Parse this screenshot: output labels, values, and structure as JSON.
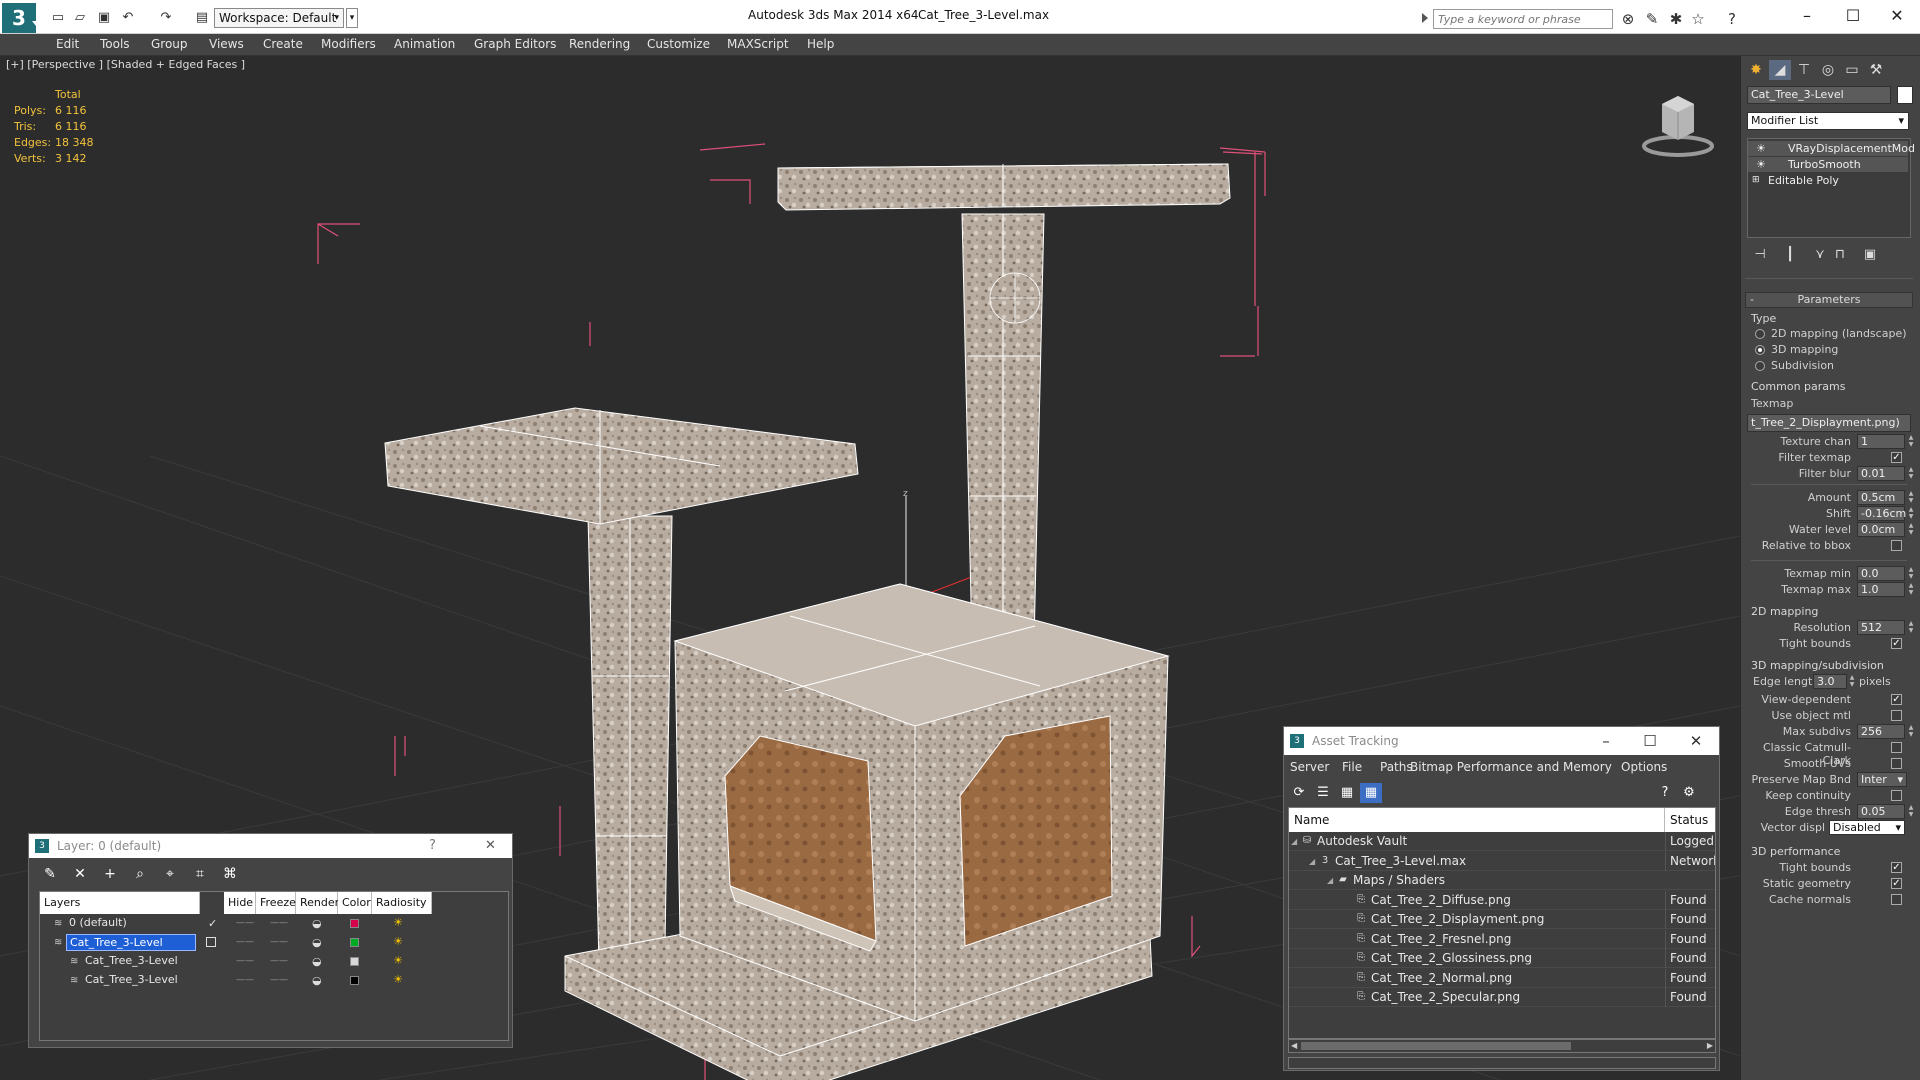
{
  "titlebar": {
    "workspace_label": "Workspace: Default",
    "app_title": "Autodesk 3ds Max  2014 x64",
    "file_title": "Cat_Tree_3-Level.max",
    "search_placeholder": "Type a keyword or phrase"
  },
  "menu": [
    "Edit",
    "Tools",
    "Group",
    "Views",
    "Create",
    "Modifiers",
    "Animation",
    "Graph Editors",
    "Rendering",
    "Customize",
    "MAXScript",
    "Help"
  ],
  "viewport": {
    "label": "[+] [Perspective ] [Shaded + Edged Faces ]",
    "stats_header": "Total",
    "stats": [
      {
        "label": "Polys:",
        "value": "6 116"
      },
      {
        "label": "Tris:",
        "value": "6 116"
      },
      {
        "label": "Edges:",
        "value": "18 348"
      },
      {
        "label": "Verts:",
        "value": "3 142"
      }
    ],
    "axis_label": "z"
  },
  "command_panel": {
    "object_name": "Cat_Tree_3-Level",
    "modifier_list": "Modifier List",
    "stack": [
      "VRayDisplacementMod",
      "TurboSmooth",
      "Editable Poly"
    ],
    "rollout_title": "Parameters",
    "type_label": "Type",
    "type_options": [
      "2D mapping (landscape)",
      "3D mapping",
      "Subdivision"
    ],
    "type_selected": 1,
    "common_label": "Common params",
    "texmap_label": "Texmap",
    "texmap_value": "t_Tree_2_Displayment.png)",
    "params": [
      {
        "label": "Texture chan",
        "value": "1"
      },
      {
        "label": "Filter texmap",
        "check": true
      },
      {
        "label": "Filter blur",
        "value": "0.01"
      },
      {
        "label": "Amount",
        "value": "0.5cm"
      },
      {
        "label": "Shift",
        "value": "-0.16cm"
      },
      {
        "label": "Water level",
        "value": "0.0cm"
      },
      {
        "label": "Relative to bbox",
        "check": false
      },
      {
        "label": "Texmap min",
        "value": "0.0"
      },
      {
        "label": "Texmap max",
        "value": "1.0"
      }
    ],
    "map2d_label": "2D mapping",
    "map2d": [
      {
        "label": "Resolution",
        "value": "512"
      },
      {
        "label": "Tight bounds",
        "check": true
      }
    ],
    "map3d_label": "3D mapping/subdivision",
    "edge_length_label": "Edge length",
    "edge_length_value": "3.0",
    "edge_length_unit": "pixels",
    "map3d": [
      {
        "label": "View-dependent",
        "check": true
      },
      {
        "label": "Use object mtl",
        "check": false
      },
      {
        "label": "Max subdivs",
        "value": "256"
      },
      {
        "label": "Classic Catmull-Clark",
        "check": false
      },
      {
        "label": "Smooth UVs",
        "check": false
      },
      {
        "label": "Preserve Map Bnd",
        "value": "Inter"
      },
      {
        "label": "Keep continuity",
        "check": false
      },
      {
        "label": "Edge thresh",
        "value": "0.05"
      },
      {
        "label": "Vector displ",
        "value": "Disabled"
      }
    ],
    "perf_label": "3D performance",
    "perf": [
      {
        "label": "Tight bounds",
        "check": true
      },
      {
        "label": "Static geometry",
        "check": true
      },
      {
        "label": "Cache normals",
        "check": false
      }
    ]
  },
  "layer_window": {
    "title": "Layer: 0 (default)",
    "help": "?",
    "close": "✕",
    "columns": [
      "Layers",
      "Hide",
      "Freeze",
      "Render",
      "Color",
      "Radiosity"
    ],
    "rows": [
      {
        "name": "0 (default)",
        "color": "#d4004c",
        "selected": false,
        "indent": 0
      },
      {
        "name": "Cat_Tree_3-Level",
        "color": "#00aa22",
        "selected": true,
        "indent": 0
      },
      {
        "name": "Cat_Tree_3-Level",
        "color": "#d8d8d8",
        "selected": false,
        "indent": 1
      },
      {
        "name": "Cat_Tree_3-Level",
        "color": "#000000",
        "selected": false,
        "indent": 1
      }
    ]
  },
  "asset_window": {
    "title": "Asset Tracking",
    "menu": [
      "Server",
      "File",
      "Paths",
      "Bitmap Performance and Memory",
      "Options"
    ],
    "columns": [
      "Name",
      "Status"
    ],
    "rows": [
      {
        "name": "Autodesk Vault",
        "status": "Logged O",
        "indent": 0,
        "icon": "vault-icon"
      },
      {
        "name": "Cat_Tree_3-Level.max",
        "status": "Network",
        "indent": 1,
        "icon": "max-file-icon"
      },
      {
        "name": "Maps / Shaders",
        "status": "",
        "indent": 2,
        "icon": "maps-icon"
      },
      {
        "name": "Cat_Tree_2_Diffuse.png",
        "status": "Found",
        "indent": 3,
        "icon": "bitmap-icon"
      },
      {
        "name": "Cat_Tree_2_Displayment.png",
        "status": "Found",
        "indent": 3,
        "icon": "bitmap-icon"
      },
      {
        "name": "Cat_Tree_2_Fresnel.png",
        "status": "Found",
        "indent": 3,
        "icon": "bitmap-icon"
      },
      {
        "name": "Cat_Tree_2_Glossiness.png",
        "status": "Found",
        "indent": 3,
        "icon": "bitmap-icon"
      },
      {
        "name": "Cat_Tree_2_Normal.png",
        "status": "Found",
        "indent": 3,
        "icon": "bitmap-icon"
      },
      {
        "name": "Cat_Tree_2_Specular.png",
        "status": "Found",
        "indent": 3,
        "icon": "bitmap-icon"
      }
    ]
  },
  "colors": {
    "accent": "#1f6f79",
    "bbox": "#e0507a",
    "stats": "#f3c33d",
    "selection": "#1e5fd6"
  }
}
